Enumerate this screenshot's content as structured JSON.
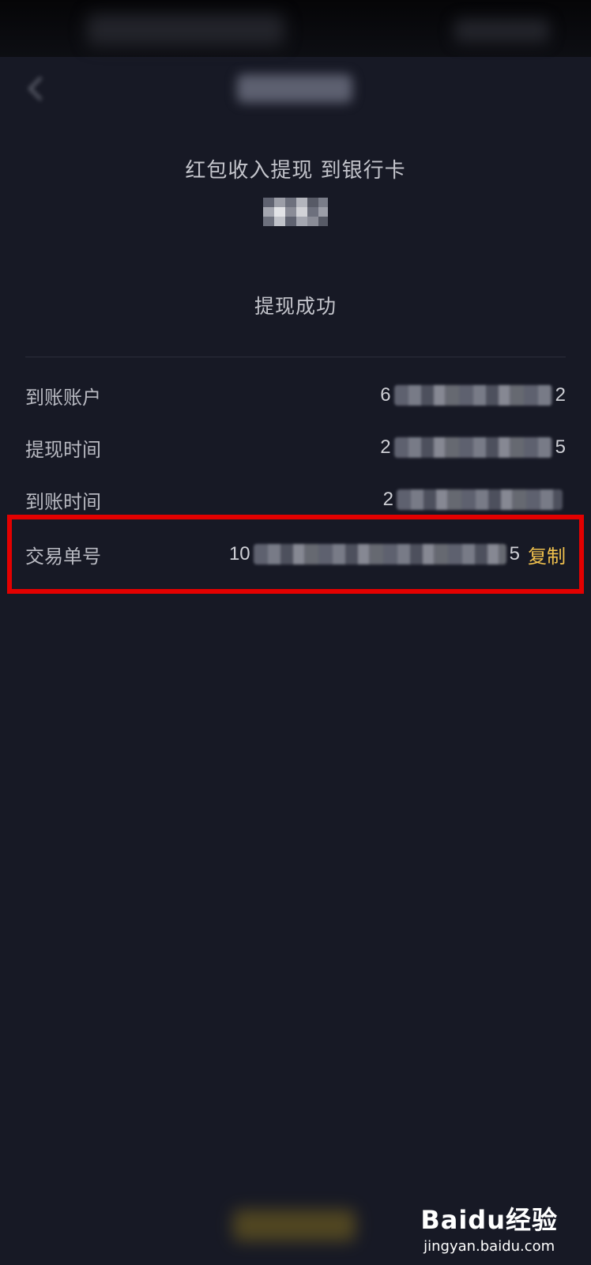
{
  "header": {
    "title": "红包收入提现 到银行卡"
  },
  "status": "提现成功",
  "details": [
    {
      "label": "到账账户",
      "value_prefix": "6",
      "value_suffix": "2"
    },
    {
      "label": "提现时间",
      "value_prefix": "2",
      "value_suffix": "5"
    },
    {
      "label": "到账时间",
      "value_prefix": "2",
      "value_suffix": ""
    },
    {
      "label": "交易单号",
      "value_prefix": "10",
      "value_suffix": "5",
      "action": "复制"
    }
  ],
  "colors": {
    "background": "#171925",
    "accent": "#f0c14d",
    "highlight": "#e30000"
  },
  "watermark": {
    "logo": "Baidu经验",
    "url": "jingyan.baidu.com"
  }
}
